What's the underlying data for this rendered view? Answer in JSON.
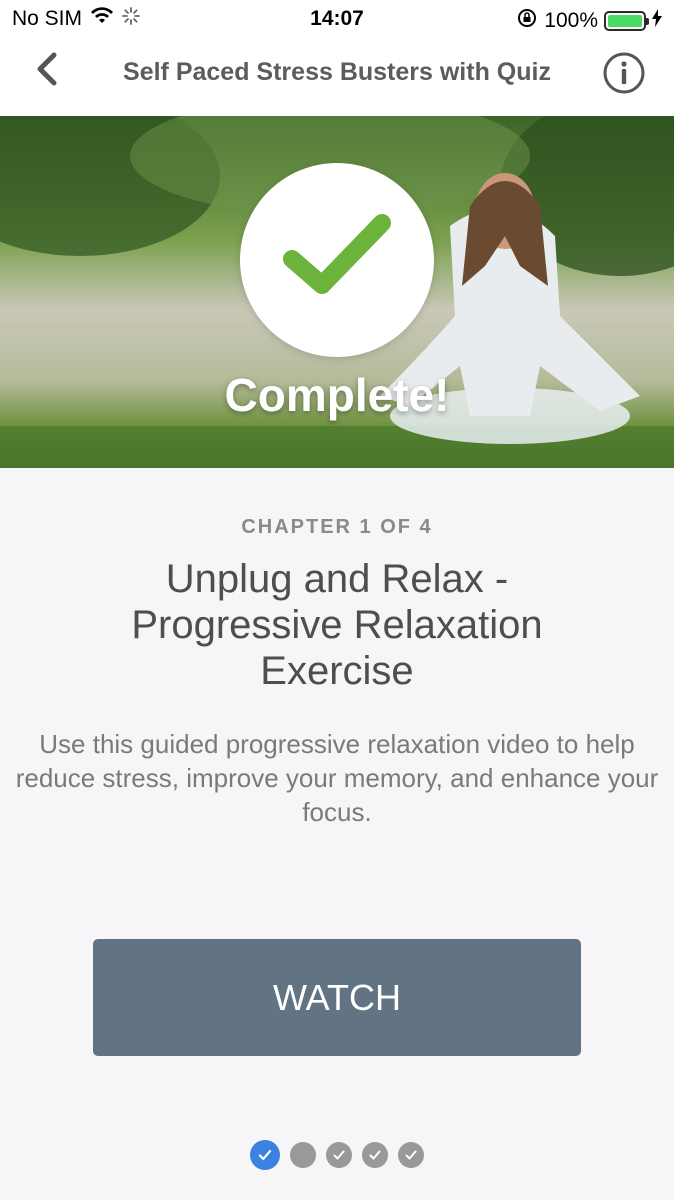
{
  "status_bar": {
    "carrier": "No SIM",
    "time": "14:07",
    "battery_percent": "100%",
    "battery_level": 1.0,
    "battery_color": "#4cd964"
  },
  "nav": {
    "title": "Self Paced Stress Busters with Quiz",
    "back_icon": "chevron-left-icon",
    "info_icon": "info-icon"
  },
  "hero": {
    "status_text": "Complete!",
    "check_color": "#6bb33a"
  },
  "chapter": {
    "label": "CHAPTER 1 OF 4",
    "title": "Unplug and Relax - Progressive Relaxation Exercise",
    "description": "Use this guided progressive relaxation video to help reduce stress, improve your memory, and enhance your focus."
  },
  "watch_button": {
    "label": "WATCH",
    "color": "#627383"
  },
  "pagination": {
    "dots": [
      {
        "state": "active-checked"
      },
      {
        "state": "plain"
      },
      {
        "state": "checked"
      },
      {
        "state": "checked"
      },
      {
        "state": "checked"
      }
    ],
    "active_color": "#3b82e0"
  }
}
